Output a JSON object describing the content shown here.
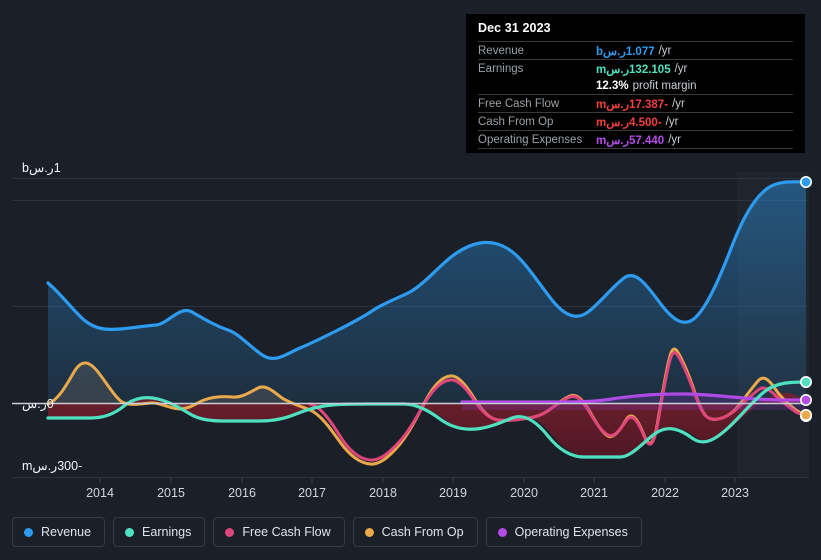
{
  "currency_symbol": "ر.س",
  "tooltip": {
    "date": "Dec 31 2023",
    "rows": [
      {
        "label": "Revenue",
        "value": "1.077ر.سb",
        "unit": "/yr"
      },
      {
        "label": "Earnings",
        "value": "132.105ر.سm",
        "unit": "/yr"
      },
      {
        "label": "",
        "value": "12.3%",
        "unit": "profit margin"
      },
      {
        "label": "Free Cash Flow",
        "value": "-17.387ر.سm",
        "unit": "/yr"
      },
      {
        "label": "Cash From Op",
        "value": "-4.500ر.سm",
        "unit": "/yr"
      },
      {
        "label": "Operating Expenses",
        "value": "57.440ر.سm",
        "unit": "/yr"
      }
    ]
  },
  "axis": {
    "y_labels": [
      {
        "text": "1ر.سb",
        "value": 1000
      },
      {
        "text": "0ر.س",
        "value": 0
      },
      {
        "text": "-300ر.سm",
        "value": -300
      }
    ],
    "x_labels": [
      "2014",
      "2015",
      "2016",
      "2017",
      "2018",
      "2019",
      "2020",
      "2021",
      "2022",
      "2023"
    ]
  },
  "legend": [
    {
      "label": "Revenue",
      "color": "#2d9bf0"
    },
    {
      "label": "Earnings",
      "color": "#4fe0c0"
    },
    {
      "label": "Free Cash Flow",
      "color": "#e0457b"
    },
    {
      "label": "Cash From Op",
      "color": "#eaa94a"
    },
    {
      "label": "Operating Expenses",
      "color": "#b44ce8"
    }
  ],
  "chart_data": {
    "type": "area",
    "title": "",
    "xlabel": "",
    "ylabel": "ر.س",
    "ylim": [
      -300,
      1100
    ],
    "grid": true,
    "legend_position": "bottom",
    "x_range": [
      "2013.5",
      "2024.0"
    ],
    "x": [
      2013.55,
      2013.8,
      2014.0,
      2014.25,
      2014.5,
      2014.75,
      2015.0,
      2015.25,
      2015.5,
      2015.75,
      2016.0,
      2016.25,
      2016.5,
      2016.75,
      2017.0,
      2017.25,
      2017.5,
      2017.75,
      2018.0,
      2018.25,
      2018.5,
      2018.75,
      2019.0,
      2019.25,
      2019.5,
      2019.75,
      2020.0,
      2020.25,
      2020.5,
      2020.75,
      2021.0,
      2021.25,
      2021.5,
      2021.75,
      2022.0,
      2022.25,
      2022.5,
      2022.75,
      2023.0,
      2023.25,
      2023.5,
      2023.75,
      2023.95
    ],
    "series": [
      {
        "name": "Revenue",
        "color": "#2d9bf0",
        "unit": "ر.سm",
        "values": [
          520,
          470,
          390,
          345,
          340,
          345,
          355,
          360,
          420,
          385,
          360,
          345,
          335,
          260,
          280,
          300,
          320,
          345,
          360,
          400,
          420,
          430,
          470,
          510,
          590,
          640,
          660,
          645,
          560,
          470,
          440,
          470,
          545,
          590,
          520,
          420,
          380,
          430,
          560,
          740,
          900,
          1030,
          1077
        ]
      },
      {
        "name": "Earnings",
        "color": "#4fe0c0",
        "unit": "ر.سm",
        "values": [
          -46,
          -46,
          -46,
          -44,
          -28,
          -12,
          -8,
          -14,
          -26,
          -34,
          -36,
          -36,
          -36,
          -34,
          -24,
          -12,
          -8,
          -8,
          -8,
          -8,
          -8,
          -10,
          -38,
          -60,
          -58,
          -54,
          -46,
          -36,
          -34,
          -46,
          -72,
          -150,
          -160,
          -160,
          -160,
          -98,
          -80,
          -104,
          -96,
          -50,
          8,
          100,
          132
        ]
      },
      {
        "name": "Free Cash Flow",
        "color": "#e0457b",
        "unit": "ر.سm",
        "values": [
          0,
          0,
          0,
          0,
          0,
          0,
          0,
          0,
          0,
          0,
          0,
          0,
          0,
          0,
          0,
          0,
          0,
          0,
          0,
          0,
          -140,
          -30,
          70,
          10,
          -40,
          -44,
          -44,
          -6,
          32,
          18,
          -120,
          -150,
          40,
          230,
          180,
          10,
          -40,
          -44,
          -20,
          90,
          130,
          40,
          -17
        ]
      },
      {
        "name": "Cash From Op",
        "color": "#eaa94a",
        "unit": "ر.سm",
        "values": [
          -2,
          10,
          70,
          110,
          60,
          8,
          0,
          10,
          4,
          -4,
          6,
          30,
          10,
          16,
          4,
          -40,
          -100,
          -140,
          -150,
          -120,
          -40,
          34,
          88,
          20,
          -40,
          -44,
          -44,
          20,
          38,
          20,
          -120,
          -150,
          50,
          240,
          190,
          20,
          -38,
          -42,
          -20,
          100,
          146,
          60,
          -4
        ]
      },
      {
        "name": "Operating Expenses",
        "color": "#b44ce8",
        "unit": "ر.سm",
        "values": [
          null,
          null,
          null,
          null,
          null,
          null,
          null,
          null,
          null,
          null,
          null,
          null,
          null,
          null,
          null,
          null,
          null,
          null,
          null,
          null,
          null,
          null,
          30,
          30,
          30,
          30,
          30,
          30,
          30,
          30,
          30,
          30,
          32,
          36,
          40,
          42,
          44,
          44,
          42,
          40,
          42,
          48,
          57
        ]
      }
    ]
  }
}
